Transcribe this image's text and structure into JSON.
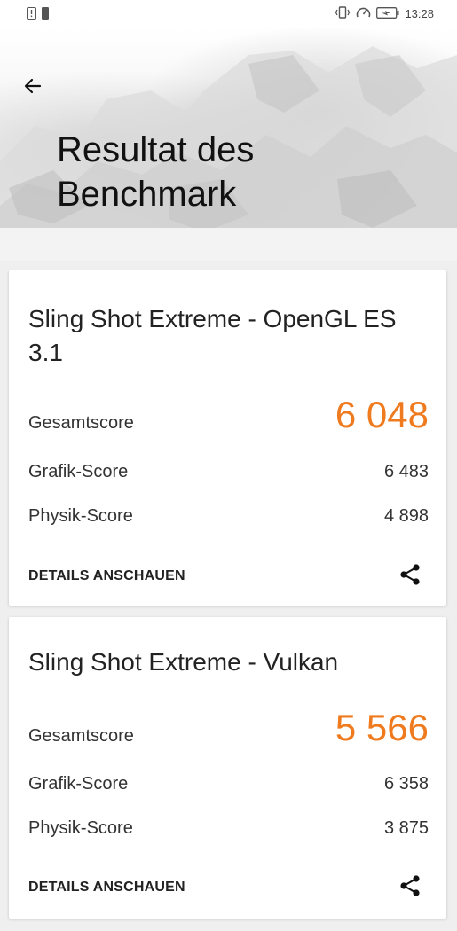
{
  "status_bar": {
    "time": "13:28",
    "left_icons": [
      "alert-icon",
      "sim-icon"
    ],
    "right_icons": [
      "vibrate-icon",
      "speed-icon",
      "battery-icon"
    ]
  },
  "header": {
    "title": "Resultat des Benchmark",
    "back_icon": "arrow-left-icon"
  },
  "results": [
    {
      "title": "Sling Shot Extreme - OpenGL ES 3.1",
      "total_label": "Gesamtscore",
      "total_value": "6 048",
      "graphics_label": "Grafik-Score",
      "graphics_value": "6 483",
      "physics_label": "Physik-Score",
      "physics_value": "4 898",
      "details_label": "DETAILS ANSCHAUEN",
      "share_icon": "share-icon"
    },
    {
      "title": "Sling Shot Extreme - Vulkan",
      "total_label": "Gesamtscore",
      "total_value": "5 566",
      "graphics_label": "Grafik-Score",
      "graphics_value": "6 358",
      "physics_label": "Physik-Score",
      "physics_value": "3 875",
      "details_label": "DETAILS ANSCHAUEN",
      "share_icon": "share-icon"
    }
  ],
  "colors": {
    "accent": "#f07b1e",
    "background": "#efefef",
    "card": "#ffffff"
  }
}
